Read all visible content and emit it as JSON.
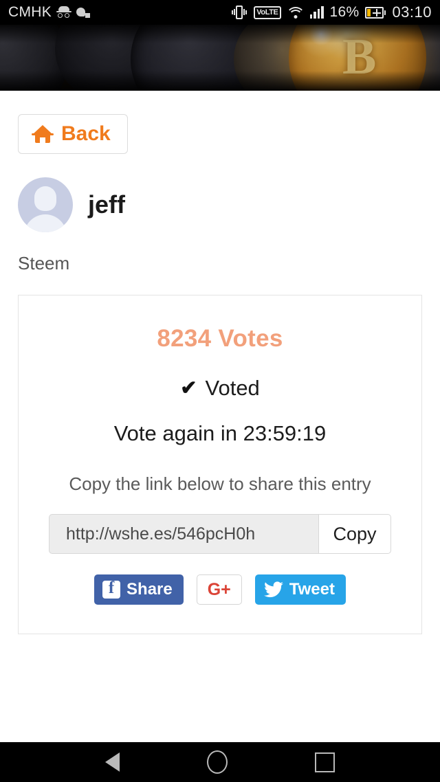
{
  "status_bar": {
    "carrier": "CMHK",
    "icons_left": [
      "incognito-icon",
      "app-icon"
    ],
    "icons_right": [
      "vibrate-icon",
      "volte-icon",
      "wifi-icon",
      "signal-icon",
      "battery-icon"
    ],
    "volte_label": "VoLTE",
    "battery_percent": "16%",
    "clock": "03:10"
  },
  "banner": {
    "alt": "cryptocurrency coins banner"
  },
  "back_button": {
    "label": "Back",
    "icon": "home-icon",
    "color": "#f07b1d"
  },
  "profile": {
    "username": "jeff",
    "avatar": "default-user-avatar",
    "platform": "Steem"
  },
  "card": {
    "votes_text": "8234 Votes",
    "votes_count": 8234,
    "votes_color": "#f2a07b",
    "voted_label": "Voted",
    "voted_icon": "check-icon",
    "vote_again_text": "Vote again in 23:59:19",
    "countdown": "23:59:19",
    "share_hint": "Copy the link below to share this entry",
    "link_value": "http://wshe.es/546pcH0h",
    "link_placeholder": "http://wshe.es/546pcH0h",
    "copy_label": "Copy",
    "social": {
      "facebook_label": "Share",
      "facebook_color": "#4162a8",
      "googleplus_label": "G+",
      "googleplus_color": "#db4437",
      "twitter_label": "Tweet",
      "twitter_color": "#27a4e8"
    }
  },
  "nav_bar": {
    "back": "nav-back-icon",
    "home": "nav-home-icon",
    "recents": "nav-recents-icon"
  }
}
